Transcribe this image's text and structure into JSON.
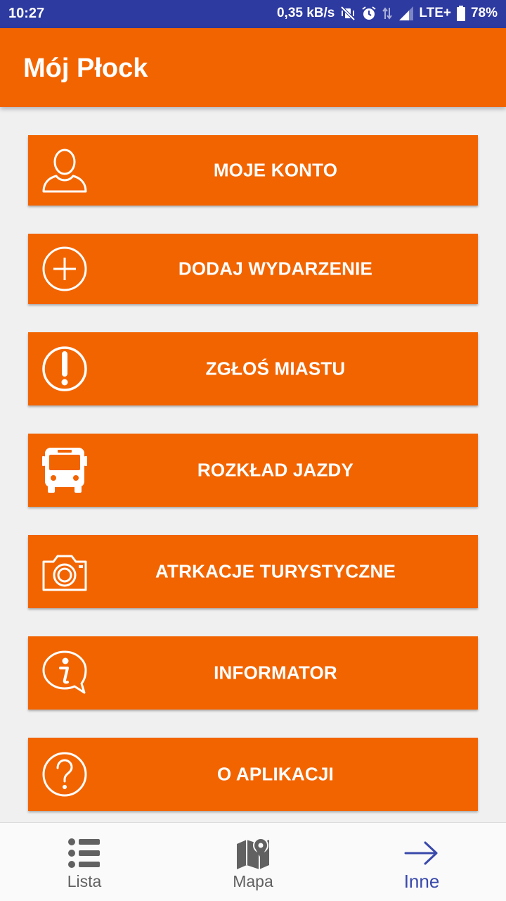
{
  "status_bar": {
    "time": "10:27",
    "net_speed": "0,35 kB/s",
    "network": "LTE+",
    "battery": "78%"
  },
  "app_bar": {
    "title": "Mój Płock"
  },
  "menu": [
    {
      "label": "MOJE KONTO",
      "icon": "person-icon"
    },
    {
      "label": "DODAJ WYDARZENIE",
      "icon": "add-circle-icon"
    },
    {
      "label": "ZGŁOŚ MIASTU",
      "icon": "alert-circle-icon"
    },
    {
      "label": "ROZKŁAD JAZDY",
      "icon": "bus-icon"
    },
    {
      "label": "ATRKACJE TURYSTYCZNE",
      "icon": "camera-icon"
    },
    {
      "label": "INFORMATOR",
      "icon": "info-bubble-icon"
    },
    {
      "label": "O APLIKACJI",
      "icon": "help-circle-icon"
    }
  ],
  "bottom_nav": [
    {
      "label": "Lista",
      "icon": "list-icon",
      "active": false
    },
    {
      "label": "Mapa",
      "icon": "map-icon",
      "active": false
    },
    {
      "label": "Inne",
      "icon": "arrow-right-icon",
      "active": true
    }
  ],
  "colors": {
    "status_bar": "#2d3aa0",
    "accent": "#f26400",
    "background": "#f0f0f0",
    "nav_active": "#3949ab",
    "nav_inactive": "#616161"
  }
}
